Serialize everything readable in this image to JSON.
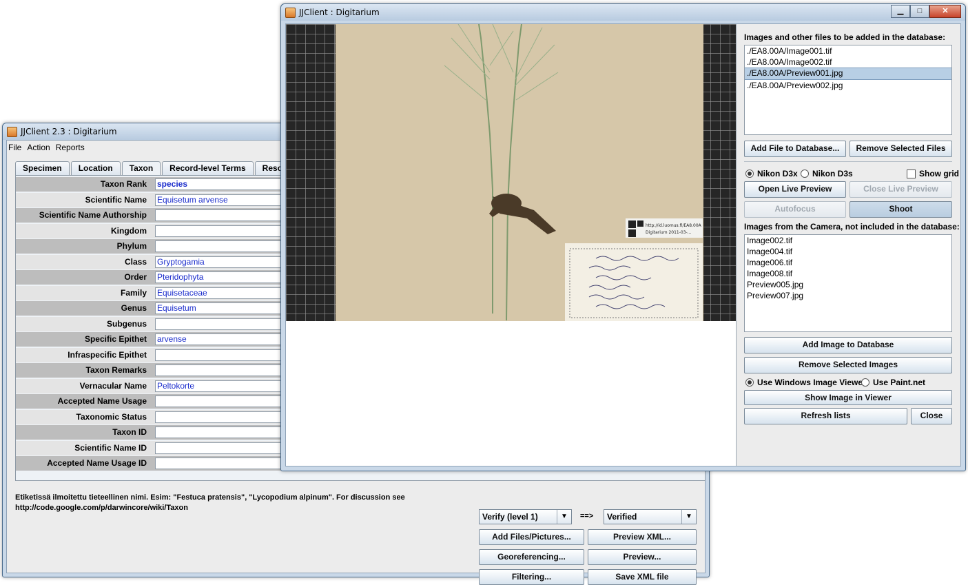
{
  "back_window": {
    "title": "JJClient 2.3 : Digitarium",
    "menu": [
      "File",
      "Action",
      "Reports"
    ],
    "tabs": [
      "Specimen",
      "Location",
      "Taxon",
      "Record-level Terms",
      "Resource Re"
    ],
    "active_tab": "Taxon",
    "fields": [
      {
        "label": "Taxon Rank",
        "value": "species"
      },
      {
        "label": "Scientific Name",
        "value": "Equisetum arvense"
      },
      {
        "label": "Scientific Name Authorship",
        "value": ""
      },
      {
        "label": "Kingdom",
        "value": ""
      },
      {
        "label": "Phylum",
        "value": ""
      },
      {
        "label": "Class",
        "value": "Gryptogamia"
      },
      {
        "label": "Order",
        "value": "Pteridophyta"
      },
      {
        "label": "Family",
        "value": "Equisetaceae"
      },
      {
        "label": "Genus",
        "value": "Equisetum"
      },
      {
        "label": "Subgenus",
        "value": ""
      },
      {
        "label": "Specific Epithet",
        "value": "arvense"
      },
      {
        "label": "Infraspecific Epithet",
        "value": ""
      },
      {
        "label": "Taxon Remarks",
        "value": ""
      },
      {
        "label": "Vernacular Name",
        "value": "Peltokorte"
      },
      {
        "label": "Accepted Name Usage",
        "value": ""
      },
      {
        "label": "Taxonomic Status",
        "value": ""
      },
      {
        "label": "Taxon ID",
        "value": ""
      },
      {
        "label": "Scientific Name ID",
        "value": ""
      },
      {
        "label": "Accepted Name Usage ID",
        "value": ""
      }
    ],
    "help_text_1": "Etiketissä ilmoitettu tieteellinen nimi. Esim: \"Festuca pratensis\", \"Lycopodium alpinum\". For discussion see",
    "help_text_2": "http://code.google.com/p/darwincore/wiki/Taxon",
    "verify_from": "Verify (level 1)",
    "verify_arrow": "==>",
    "verify_to": "Verified",
    "buttons": {
      "add_files": "Add Files/Pictures...",
      "preview_xml": "Preview XML...",
      "georef": "Georeferencing...",
      "preview": "Preview...",
      "filtering": "Filtering...",
      "save_xml": "Save XML file"
    }
  },
  "front_window": {
    "title": "JJClient : Digitarium",
    "image_stamp_1": "http://id.luomus.fi/EA8.00A",
    "image_stamp_2": "Digitarium 2011-03-...",
    "files_label": "Images and other files to be added in the database:",
    "files": [
      "./EA8.00A/Image001.tif",
      "./EA8.00A/Image002.tif",
      "./EA8.00A/Preview001.jpg",
      "./EA8.00A/Preview002.jpg"
    ],
    "selected_file_index": 2,
    "add_file_btn": "Add File to Database...",
    "remove_files_btn": "Remove Selected Files",
    "camera_options": [
      "Nikon D3x",
      "Nikon D3s"
    ],
    "camera_selected": "Nikon D3x",
    "show_grid_label": "Show grid",
    "show_grid_checked": false,
    "open_preview_btn": "Open Live Preview",
    "close_preview_btn": "Close Live Preview",
    "autofocus_btn": "Autofocus",
    "shoot_btn": "Shoot",
    "camera_label": "Images from the Camera, not included in the database:",
    "camera_files": [
      "Image002.tif",
      "Image004.tif",
      "Image006.tif",
      "Image008.tif",
      "Preview005.jpg",
      "Preview007.jpg"
    ],
    "add_image_btn": "Add Image to Database",
    "remove_images_btn": "Remove Selected Images",
    "viewer_options": [
      "Use Windows Image Viewer",
      "Use Paint.net"
    ],
    "viewer_selected": "Use Windows Image Viewer",
    "show_image_btn": "Show Image in Viewer",
    "refresh_btn": "Refresh lists",
    "close_btn": "Close"
  }
}
